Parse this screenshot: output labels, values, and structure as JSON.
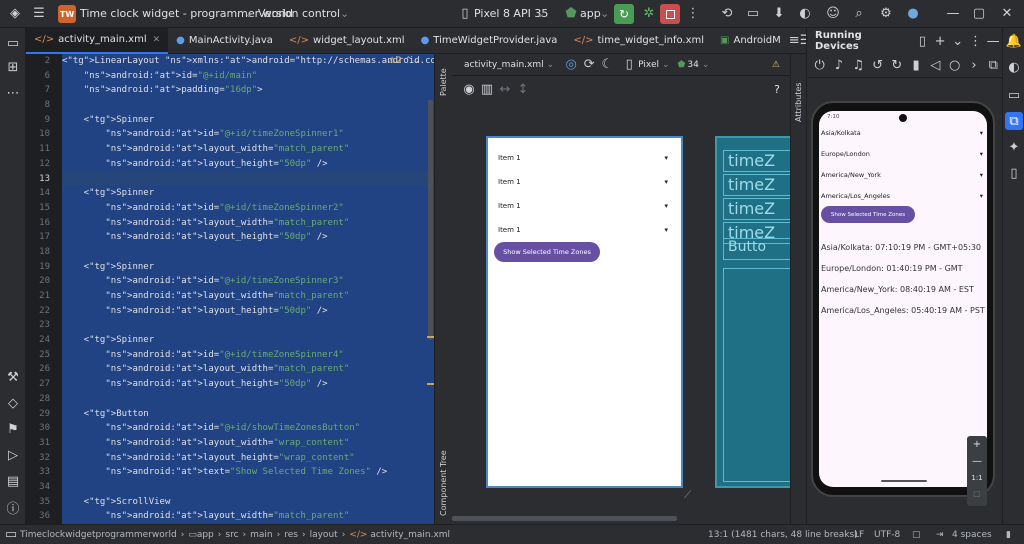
{
  "titlebar": {
    "project_badge": "TW",
    "title": "Time clock widget - programmer world",
    "vcs": "Version control",
    "device": "Pixel 8 API 35",
    "run_config": "app"
  },
  "tabs": [
    {
      "label": "activity_main.xml"
    },
    {
      "label": "MainActivity.java"
    },
    {
      "label": "widget_layout.xml"
    },
    {
      "label": "TimeWidgetProvider.java"
    },
    {
      "label": "time_widget_info.xml"
    },
    {
      "label": "AndroidM"
    }
  ],
  "editor": {
    "line_numbers": [
      "2",
      "6",
      "7",
      "8",
      "9",
      "10",
      "11",
      "12",
      "13",
      "14",
      "15",
      "16",
      "17",
      "18",
      "19",
      "20",
      "21",
      "22",
      "23",
      "24",
      "25",
      "26",
      "27",
      "28",
      "29",
      "30",
      "31",
      "32",
      "33",
      "34",
      "35",
      "36"
    ],
    "lines": [
      "<LinearLayout xmlns:android=\"http://schemas.android.com/apk/",
      "    android:id=\"@+id/main\"",
      "    android:padding=\"16dp\">",
      "",
      "    <Spinner",
      "        android:id=\"@+id/timeZoneSpinner1\"",
      "        android:layout_width=\"match_parent\"",
      "        android:layout_height=\"50dp\" />",
      "",
      "    <Spinner",
      "        android:id=\"@+id/timeZoneSpinner2\"",
      "        android:layout_width=\"match_parent\"",
      "        android:layout_height=\"50dp\" />",
      "",
      "    <Spinner",
      "        android:id=\"@+id/timeZoneSpinner3\"",
      "        android:layout_width=\"match_parent\"",
      "        android:layout_height=\"50dp\" />",
      "",
      "    <Spinner",
      "        android:id=\"@+id/timeZoneSpinner4\"",
      "        android:layout_width=\"match_parent\"",
      "        android:layout_height=\"50dp\" />",
      "",
      "    <Button",
      "        android:id=\"@+id/showTimeZonesButton\"",
      "        android:layout_width=\"wrap_content\"",
      "        android:layout_height=\"wrap_content\"",
      "        android:text=\"Show Selected Time Zones\" />",
      "",
      "    <ScrollView",
      "        android:layout_width=\"match_parent\""
    ],
    "warning_count": "2"
  },
  "side_labels": {
    "palette": "Palette",
    "component_tree": "Component Tree",
    "attributes": "Attributes"
  },
  "design": {
    "file": "activity_main.xml",
    "device": "Pixel",
    "api": "34",
    "help": "?",
    "spinner_items": [
      "Item 1",
      "Item 1",
      "Item 1",
      "Item 1"
    ],
    "button": "Show Selected Time Zones",
    "blueprint_labels": [
      "timeZ",
      "timeZ",
      "timeZ",
      "timeZ",
      "Butto"
    ]
  },
  "running": {
    "title": "Running Devices",
    "time": "7:10",
    "zones": [
      "Asia/Kolkata",
      "Europe/London",
      "America/New_York",
      "America/Los_Angeles"
    ],
    "button": "Show Selected Time Zones",
    "results": [
      "Asia/Kolkata: 07:10:19 PM - GMT+05:30",
      "Europe/London: 01:40:19 PM - GMT",
      "America/New_York: 08:40:19 AM - EST",
      "America/Los_Angeles: 05:40:19 AM - PST"
    ],
    "zoom_plus": "+",
    "zoom_minus": "—",
    "zoom_ratio": "1:1"
  },
  "statusbar": {
    "breadcrumbs": [
      "Timeclockwidgetprogrammerworld",
      "app",
      "src",
      "main",
      "res",
      "layout",
      "activity_main.xml"
    ],
    "position": "13:1 (1481 chars, 48 line breaks)",
    "line_sep": "LF",
    "encoding": "UTF-8",
    "indent": "4 spaces"
  },
  "colors": {
    "accent": "#3574f0",
    "run_green": "#499c54",
    "stop_red": "#c94f4f",
    "button_purple": "#6750a4",
    "selection": "#214283"
  }
}
